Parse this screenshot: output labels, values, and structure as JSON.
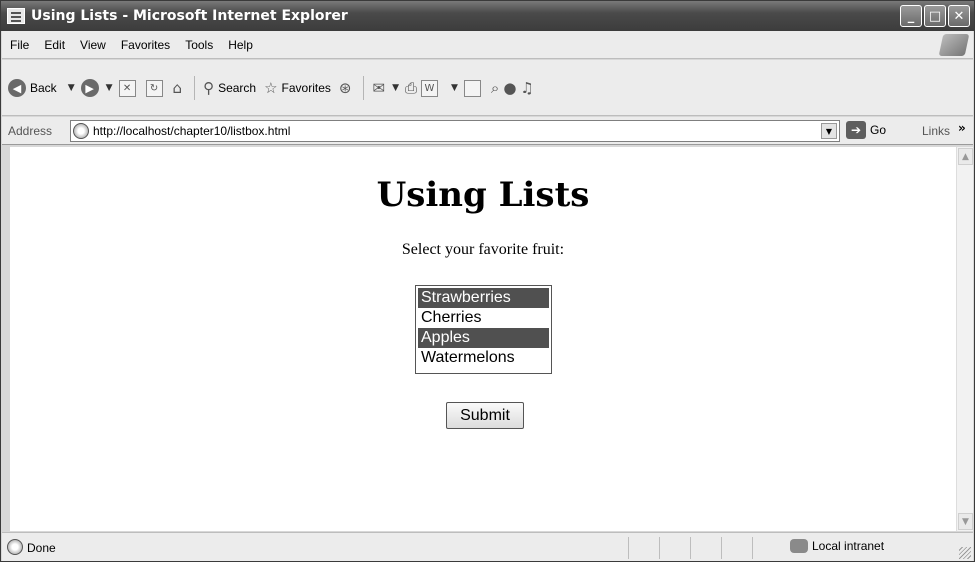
{
  "window": {
    "title": "Using Lists - Microsoft Internet Explorer"
  },
  "menu": [
    "File",
    "Edit",
    "View",
    "Favorites",
    "Tools",
    "Help"
  ],
  "toolbar": {
    "back": "Back",
    "search": "Search",
    "favorites": "Favorites"
  },
  "address": {
    "label": "Address",
    "url": "http://localhost/chapter10/listbox.html",
    "go": "Go",
    "links": "Links",
    "links_more": "»"
  },
  "page": {
    "title": "Using Lists",
    "prompt": "Select your favorite fruit:",
    "options": [
      {
        "label": "Strawberries",
        "selected": true
      },
      {
        "label": "Cherries",
        "selected": false
      },
      {
        "label": "Apples",
        "selected": true
      },
      {
        "label": "Watermelons",
        "selected": false
      }
    ],
    "submit": "Submit"
  },
  "status": {
    "text": "Done",
    "zone": "Local intranet"
  }
}
